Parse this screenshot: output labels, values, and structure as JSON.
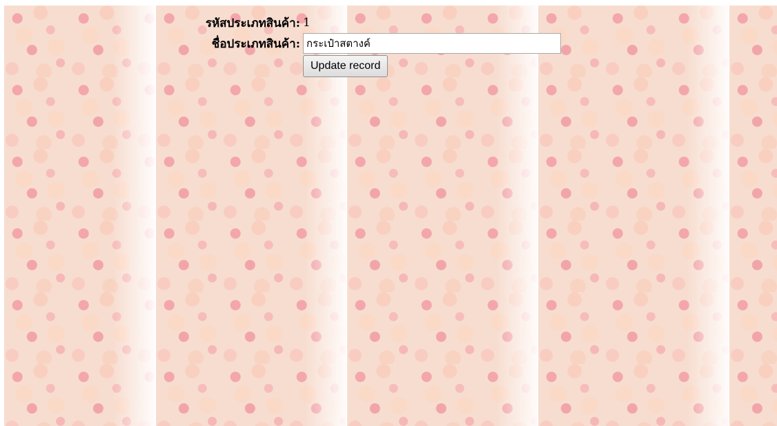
{
  "form": {
    "id_label": "รหัสประเภทสินค้า:",
    "id_value": "1",
    "name_label": "ชื่อประเภทสินค้า:",
    "name_value": "กระเป๋าสตางค์",
    "submit_label": "Update record"
  }
}
